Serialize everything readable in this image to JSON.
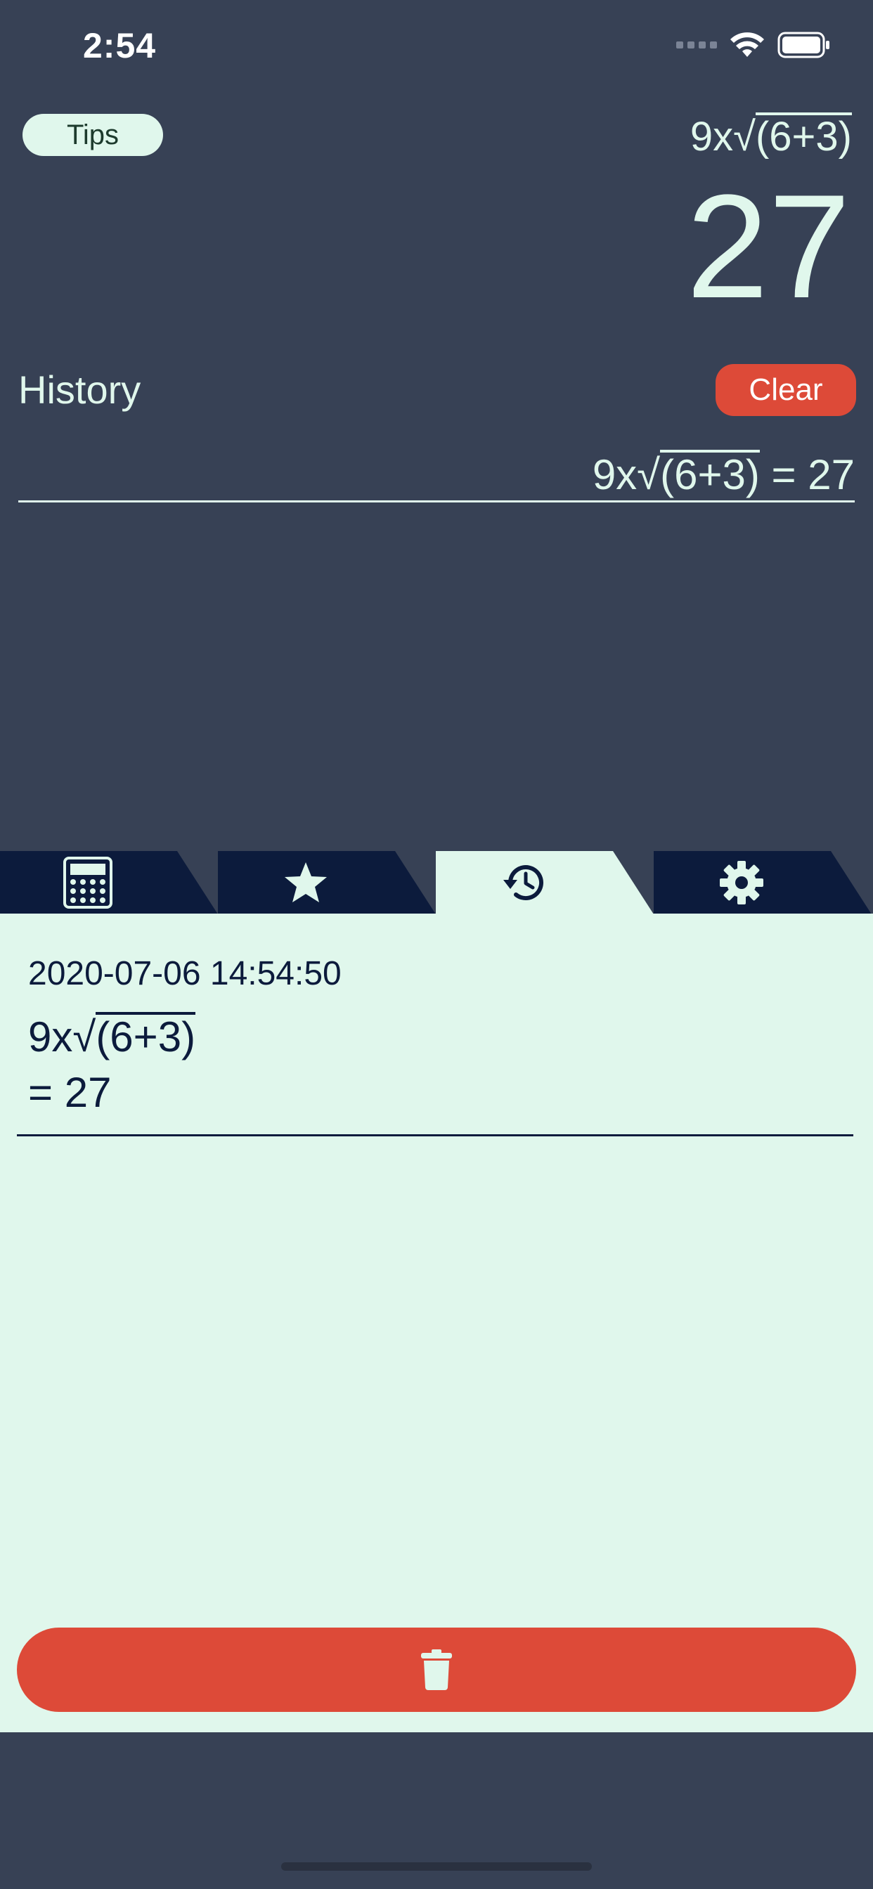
{
  "status_bar": {
    "time": "2:54",
    "icons": [
      "cellular-dots-icon",
      "wifi-icon",
      "battery-icon"
    ]
  },
  "header": {
    "tips_label": "Tips",
    "expression": {
      "prefix": "9x√",
      "radicand": "(6+3)"
    },
    "result": "27"
  },
  "history": {
    "title": "History",
    "clear_label": "Clear",
    "entries": [
      {
        "prefix": "9x√",
        "radicand": "(6+3)",
        "suffix": " = 27"
      }
    ]
  },
  "tabs": [
    {
      "icon": "calculator-icon",
      "active": false
    },
    {
      "icon": "star-icon",
      "active": false
    },
    {
      "icon": "history-icon",
      "active": true
    },
    {
      "icon": "gear-icon",
      "active": false
    }
  ],
  "detail": {
    "date": "2020-07-06 14:54:50",
    "expression": {
      "prefix": "9x√",
      "radicand": "(6+3)"
    },
    "result": "= 27"
  },
  "actions": {
    "delete_icon": "trash-icon"
  },
  "colors": {
    "background": "#374155",
    "panel": "#e0f7ec",
    "accent_red": "#dd4a38",
    "tab_dark": "#0c1b3c",
    "text_light": "#e0f7ec",
    "text_dark": "#0c1b3c"
  }
}
